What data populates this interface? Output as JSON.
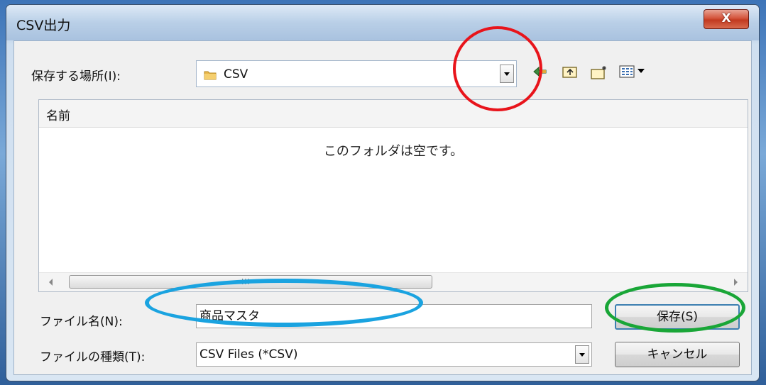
{
  "window": {
    "title": "CSV出力",
    "close_label": "X"
  },
  "lookin": {
    "label": "保存する場所(I):",
    "value": "CSV"
  },
  "toolbar": {
    "icons": [
      "back-icon",
      "up-folder-icon",
      "new-folder-icon",
      "view-menu-icon"
    ]
  },
  "filelist": {
    "column_name": "名前",
    "empty_message": "このフォルダは空です。",
    "scroll_grip": "III"
  },
  "filename": {
    "label": "ファイル名(N):",
    "value": "商品マスタ"
  },
  "filetype": {
    "label": "ファイルの種類(T):",
    "value": "CSV Files (*CSV)"
  },
  "buttons": {
    "save": "保存(S)",
    "cancel": "キャンセル"
  },
  "annotations": {
    "colors": {
      "red": "#e8141b",
      "blue": "#1aa3e0",
      "green": "#19a637"
    }
  }
}
